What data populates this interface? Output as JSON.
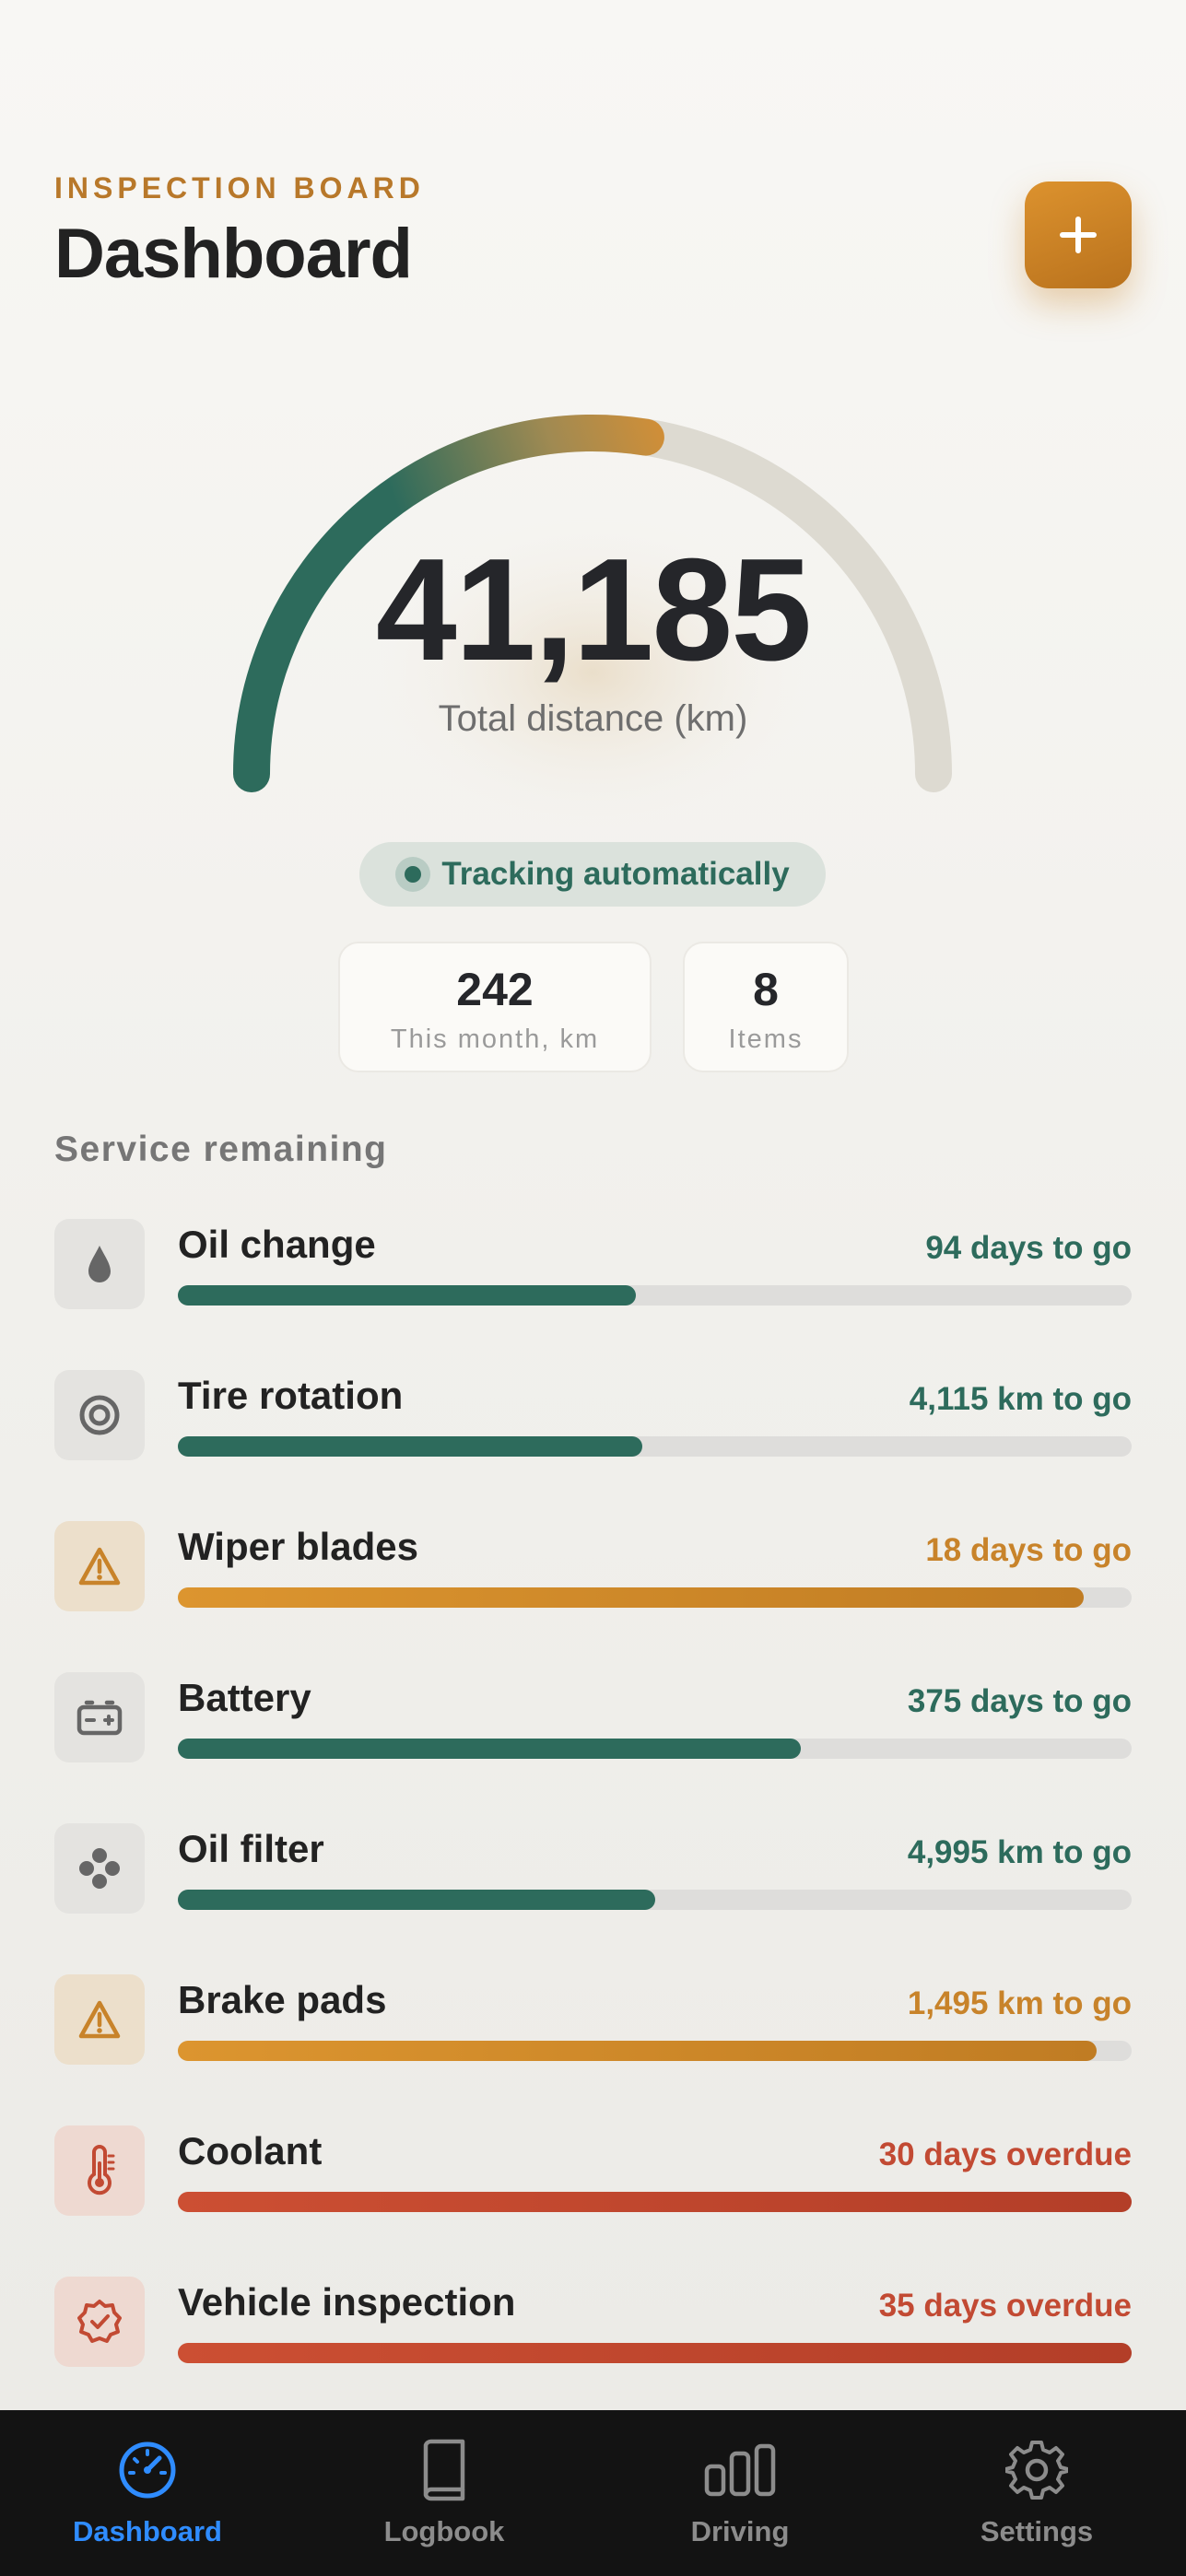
{
  "header": {
    "eyebrow": "INSPECTION BOARD",
    "title": "Dashboard",
    "add_icon": "plus-icon"
  },
  "odometer": {
    "value": "41,185",
    "label": "Total distance (km)",
    "progress_fraction": 0.55
  },
  "tracking": {
    "label": "Tracking automatically"
  },
  "stats": [
    {
      "value": "242",
      "label": "This month, km"
    },
    {
      "value": "8",
      "label": "Items"
    }
  ],
  "services": {
    "title": "Service remaining",
    "items": [
      {
        "name": "Oil change",
        "status": "94 days to go",
        "level": "green",
        "progress": 0.48,
        "icon": "drop-icon",
        "icon_bg": "gray"
      },
      {
        "name": "Tire rotation",
        "status": "4,115 km to go",
        "level": "green",
        "progress": 0.487,
        "icon": "tire-icon",
        "icon_bg": "gray"
      },
      {
        "name": "Wiper blades",
        "status": "18 days to go",
        "level": "orange",
        "progress": 0.95,
        "icon": "warning-icon",
        "icon_bg": "orange"
      },
      {
        "name": "Battery",
        "status": "375 days to go",
        "level": "green",
        "progress": 0.653,
        "icon": "battery-icon",
        "icon_bg": "gray"
      },
      {
        "name": "Oil filter",
        "status": "4,995 km to go",
        "level": "green",
        "progress": 0.5,
        "icon": "filter-icon",
        "icon_bg": "gray"
      },
      {
        "name": "Brake pads",
        "status": "1,495 km to go",
        "level": "orange",
        "progress": 0.963,
        "icon": "warning-icon",
        "icon_bg": "orange"
      },
      {
        "name": "Coolant",
        "status": "30 days overdue",
        "level": "red",
        "progress": 1.0,
        "icon": "thermometer-icon",
        "icon_bg": "red"
      },
      {
        "name": "Vehicle inspection",
        "status": "35 days overdue",
        "level": "red",
        "progress": 1.0,
        "icon": "badge-check-icon",
        "icon_bg": "red"
      }
    ]
  },
  "tabbar": {
    "tabs": [
      {
        "label": "Dashboard",
        "icon": "speedometer-icon",
        "active": true
      },
      {
        "label": "Logbook",
        "icon": "book-icon",
        "active": false
      },
      {
        "label": "Driving",
        "icon": "bar-chart-icon",
        "active": false
      },
      {
        "label": "Settings",
        "icon": "gear-icon",
        "active": false
      }
    ]
  },
  "colors": {
    "accent": "#c8832a",
    "green": "#2d6b5c",
    "red": "#c24a33",
    "active_tab": "#2f8cff"
  }
}
